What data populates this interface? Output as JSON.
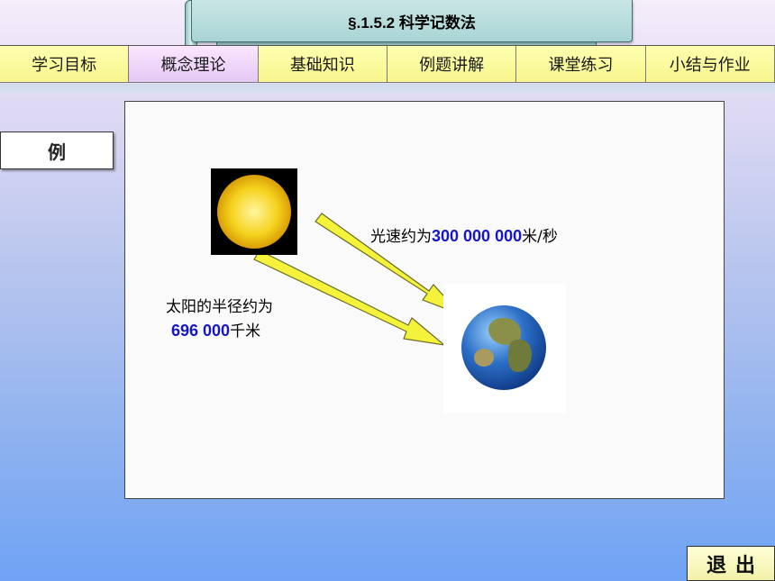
{
  "header": {
    "title": "§.1.5.2 科学记数法"
  },
  "nav": {
    "tabs": [
      {
        "label": "学习目标"
      },
      {
        "label": "概念理论"
      },
      {
        "label": "基础知识"
      },
      {
        "label": "例题讲解"
      },
      {
        "label": "课堂练习"
      },
      {
        "label": "小结与作业"
      }
    ],
    "active_tab": "概念理论"
  },
  "example": {
    "label": "例"
  },
  "content": {
    "speed_prefix": "光速约为",
    "speed_value": "300 000 000",
    "speed_unit": "米/秒",
    "radius_prefix": "太阳的半径约为",
    "radius_value": "696 000",
    "radius_unit": "千米",
    "images": [
      "sun",
      "earth"
    ]
  },
  "footer": {
    "exit_label": "退出"
  },
  "colors": {
    "number": "#1616c8",
    "tab": "#f6f58c",
    "active_tab": "#e4c8f4",
    "arrow": "#f4f23a"
  }
}
